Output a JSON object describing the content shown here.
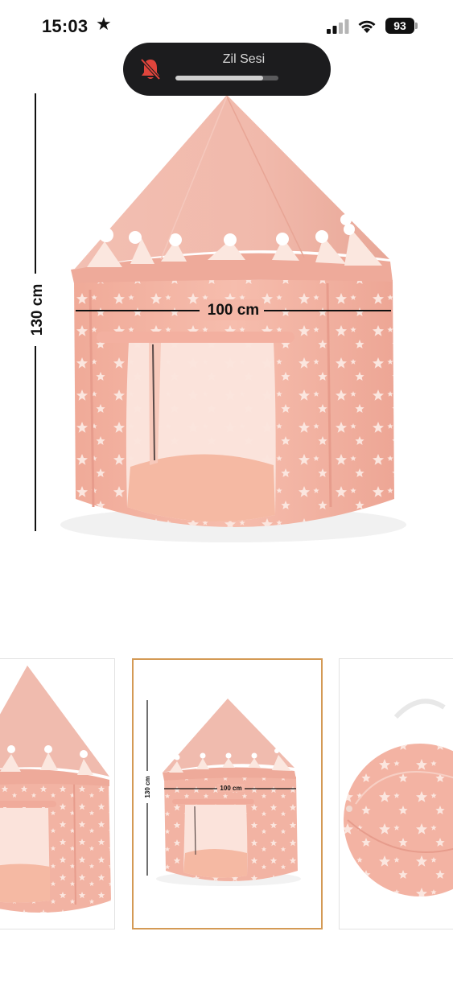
{
  "status_bar": {
    "time": "15:03",
    "battery_level": "93"
  },
  "volume_popup": {
    "label": "Zil Sesi",
    "level": 0.85
  },
  "main_image": {
    "height_label": "130 cm",
    "width_label": "100 cm"
  },
  "thumbnails": [
    {
      "selected": false
    },
    {
      "selected": true,
      "height_label": "130 cm",
      "width_label": "100 cm"
    },
    {
      "selected": false
    }
  ],
  "colors": {
    "tent_pink": "#f3b5a5",
    "tent_roof": "#efb7aa",
    "tent_floor": "#f5c2b0",
    "selected_border": "#d49a55",
    "island_bg": "#1c1c1e",
    "muted_red": "#e0453c"
  }
}
